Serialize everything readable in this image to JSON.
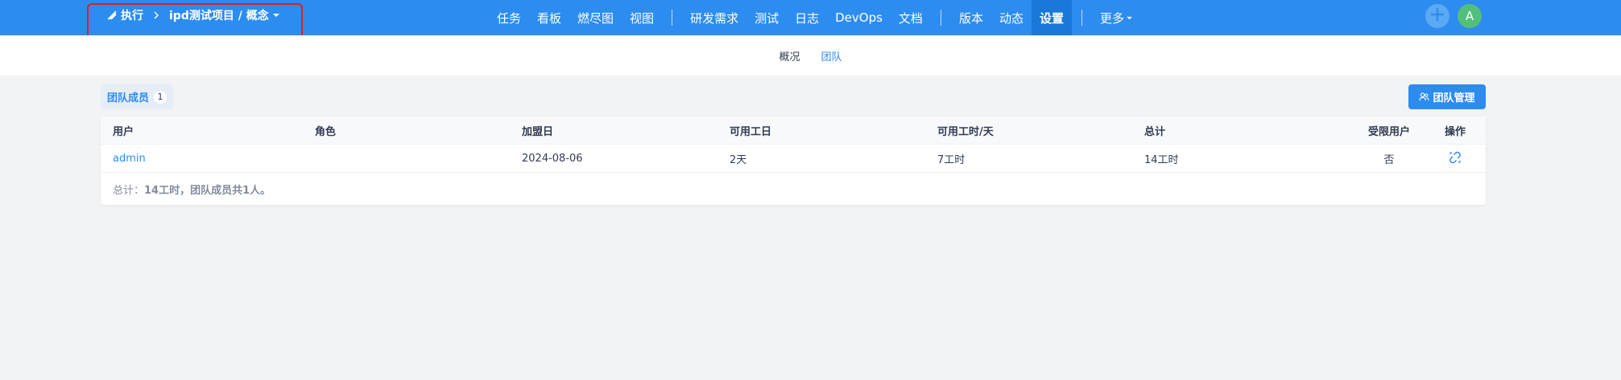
{
  "breadcrumb": {
    "root": "执行",
    "project": "ipd测试项目 / 概念"
  },
  "nav": {
    "items": [
      "任务",
      "看板",
      "燃尽图",
      "视图"
    ],
    "items2": [
      "研发需求",
      "测试",
      "日志",
      "DevOps",
      "文档"
    ],
    "items3": [
      "版本",
      "动态",
      "设置"
    ],
    "more": "更多",
    "active": "设置"
  },
  "user": {
    "avatar_letter": "A"
  },
  "subnav": {
    "tabs": [
      "概况",
      "团队"
    ],
    "active": "团队"
  },
  "toolbar": {
    "members_label": "团队成员",
    "members_count": "1",
    "manage_label": "团队管理"
  },
  "table": {
    "headers": [
      "用户",
      "角色",
      "加盟日",
      "可用工日",
      "可用工时/天",
      "总计",
      "受限用户",
      "操作"
    ],
    "rows": [
      {
        "user": "admin",
        "role": "",
        "join": "2024-08-06",
        "days": "2天",
        "hours": "7工时",
        "total": "14工时",
        "limited": "否"
      }
    ],
    "summary_prefix": "总计：",
    "summary_bold": "14工时，团队成员共1人。"
  },
  "colors": {
    "primary": "#2d8cf0",
    "highlight": "#e02020"
  },
  "icons": [
    "execution-icon",
    "chevron-right-icon",
    "caret-down-icon",
    "plus-icon",
    "team-icon",
    "unlink-icon"
  ]
}
